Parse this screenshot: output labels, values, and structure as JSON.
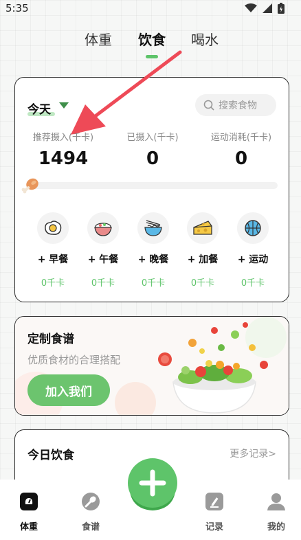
{
  "status_bar": {
    "time": "5:35"
  },
  "tabs": [
    {
      "label": "体重",
      "active": false
    },
    {
      "label": "饮食",
      "active": true
    },
    {
      "label": "喝水",
      "active": false
    }
  ],
  "today_card": {
    "title": "今天",
    "search_placeholder": "搜索食物",
    "stats": [
      {
        "label": "推荐摄入(千卡)",
        "value": "1494"
      },
      {
        "label": "已摄入(千卡)",
        "value": "0"
      },
      {
        "label": "运动消耗(千卡)",
        "value": "0"
      }
    ],
    "progress_fraction": 0,
    "meals": [
      {
        "name": "+ 早餐",
        "kcal": "0千卡",
        "icon": "egg-icon"
      },
      {
        "name": "+ 午餐",
        "kcal": "0千卡",
        "icon": "rice-bowl-icon"
      },
      {
        "name": "+ 晚餐",
        "kcal": "0千卡",
        "icon": "noodle-bowl-icon"
      },
      {
        "name": "+ 加餐",
        "kcal": "0千卡",
        "icon": "cheese-icon"
      },
      {
        "name": "+ 运动",
        "kcal": "0千卡",
        "icon": "basketball-icon"
      }
    ]
  },
  "recipe_card": {
    "title": "定制食谱",
    "subtitle": "优质食材的合理搭配",
    "button_label": "加入我们"
  },
  "diet_card": {
    "title": "今日饮食",
    "more_link": "更多记录>"
  },
  "bottom_nav": [
    {
      "label": "体重",
      "icon": "scale-icon",
      "active": true
    },
    {
      "label": "食谱",
      "icon": "spoon-icon",
      "active": false
    },
    {
      "label": "记录",
      "icon": "edit-icon",
      "active": false
    },
    {
      "label": "我的",
      "icon": "user-icon",
      "active": false
    }
  ],
  "colors": {
    "accent_green": "#5ec46a",
    "button_green": "#6cc46e",
    "annotation_red": "#ee4a57"
  }
}
